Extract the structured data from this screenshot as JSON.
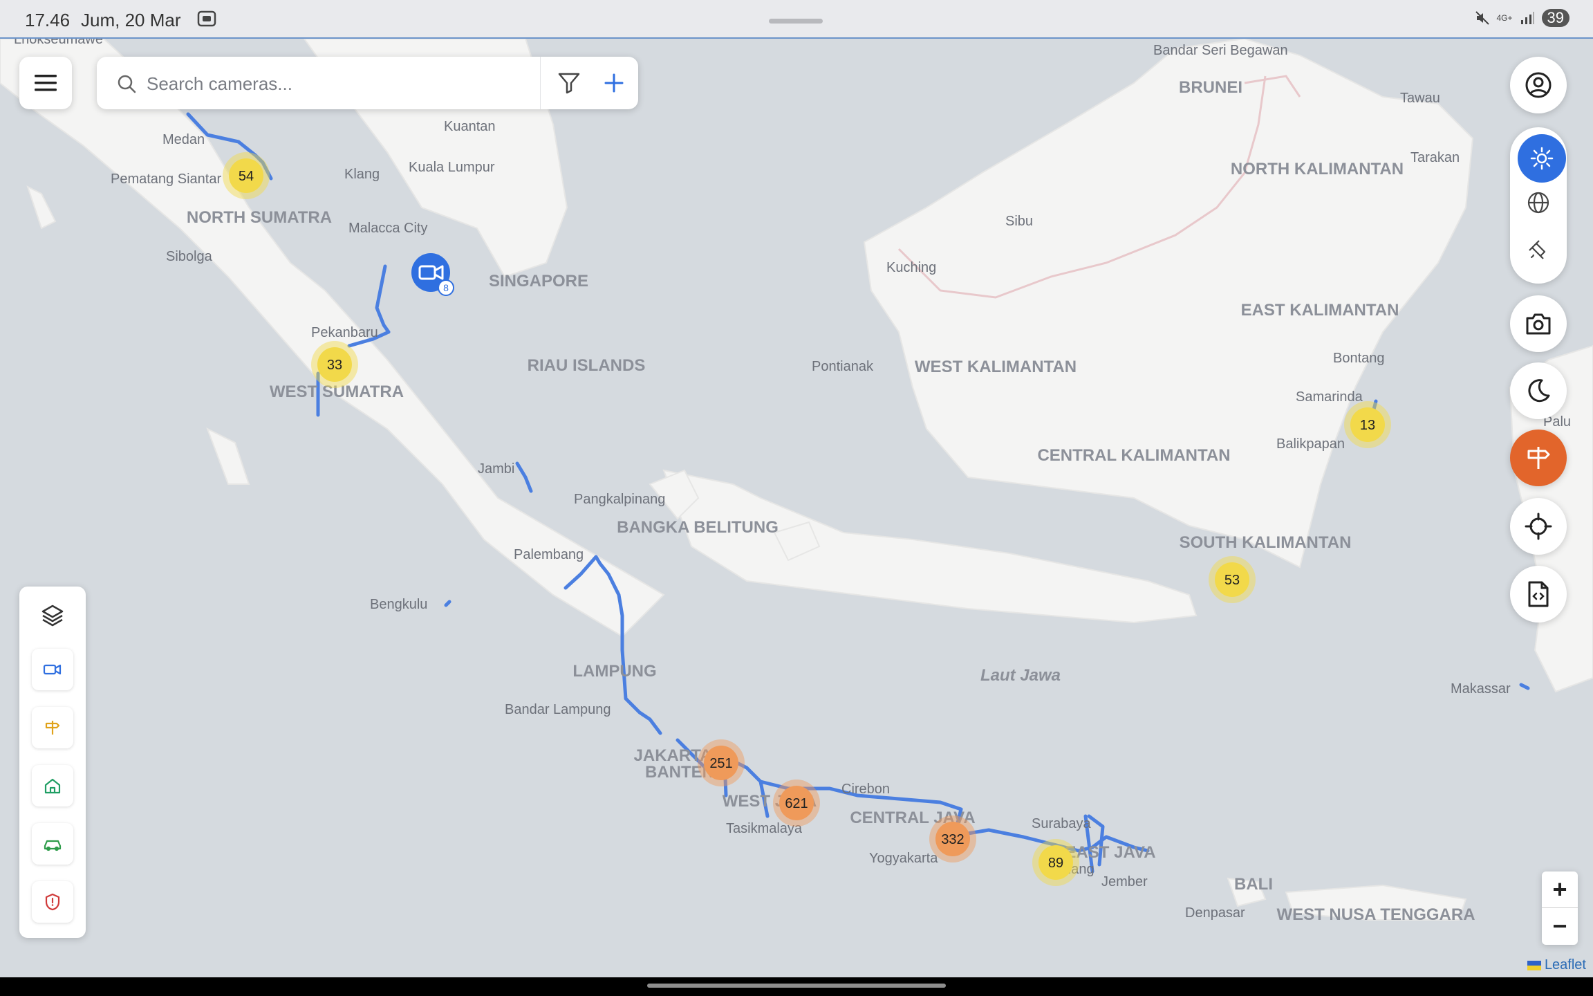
{
  "status_bar": {
    "time": "17.46",
    "date": "Jum, 20 Mar",
    "network_label": "4G+",
    "battery": "39"
  },
  "search": {
    "placeholder": "Search cameras..."
  },
  "map": {
    "region_labels": [
      {
        "name": "NORTH SUMATRA"
      },
      {
        "name": "WEST SUMATRA"
      },
      {
        "name": "RIAU ISLANDS"
      },
      {
        "name": "BANGKA BELITUNG"
      },
      {
        "name": "LAMPUNG"
      },
      {
        "name": "SINGAPORE"
      },
      {
        "name": "BRUNEI"
      },
      {
        "name": "NORTH KALIMANTAN"
      },
      {
        "name": "EAST KALIMANTAN"
      },
      {
        "name": "WEST KALIMANTAN"
      },
      {
        "name": "CENTRAL KALIMANTAN"
      },
      {
        "name": "SOUTH KALIMANTAN"
      },
      {
        "name": "BALI"
      },
      {
        "name": "WEST NUSA TENGGARA"
      },
      {
        "name": "JAKARTA"
      },
      {
        "name": "BANTEN"
      },
      {
        "name": "WEST JAVA"
      },
      {
        "name": "CENTRAL JAVA"
      },
      {
        "name": "EAST JAVA"
      },
      {
        "name": "Laut Jawa"
      }
    ],
    "city_labels": [
      "Lhokseumawe",
      "Medan",
      "Pematang Siantar",
      "Sibolga",
      "Pekanbaru",
      "Jambi",
      "Bengkulu",
      "Palembang",
      "Pangkalpinang",
      "Bandar Lampung",
      "Kuantan",
      "Kuala Lumpur",
      "Klang",
      "Malacca City",
      "Bandar Seri Begawan",
      "Tawau",
      "Tarakan",
      "Sibu",
      "Kuching",
      "Pontianak",
      "Bontang",
      "Samarinda",
      "Balikpapan",
      "Makassar",
      "Palu",
      "Cirebon",
      "Tasikmalaya",
      "Yogyakarta",
      "Surabaya",
      "Malang",
      "Jember",
      "Denpasar"
    ],
    "clusters": [
      {
        "count": "54",
        "level": "yellow"
      },
      {
        "count": "33",
        "level": "yellow"
      },
      {
        "count": "13",
        "level": "yellow"
      },
      {
        "count": "53",
        "level": "yellow"
      },
      {
        "count": "251",
        "level": "orange"
      },
      {
        "count": "621",
        "level": "orange"
      },
      {
        "count": "332",
        "level": "orange"
      },
      {
        "count": "89",
        "level": "yellow"
      }
    ],
    "camera_marker": {
      "badge": "8",
      "icon": "video-camera-icon"
    },
    "colors": {
      "water": "#d5dadf",
      "land": "#f4f4f3",
      "route": "#4b7fe0",
      "cluster_yellow": "#f2d94a",
      "cluster_orange": "#ef9a5a",
      "accent_blue": "#2f6fe0",
      "accent_orange": "#e2652b"
    }
  },
  "right_controls": [
    "user-icon",
    "sun-icon",
    "globe-icon",
    "satellite-icon",
    "camera-icon",
    "moon-icon",
    "signpost-icon",
    "locate-icon",
    "file-code-icon"
  ],
  "left_panel": [
    "layers-icon",
    "video-camera-icon",
    "signpost-icon",
    "home-icon",
    "car-icon",
    "shield-icon"
  ],
  "zoom": {
    "in": "+",
    "out": "−"
  },
  "attribution": "Leaflet"
}
